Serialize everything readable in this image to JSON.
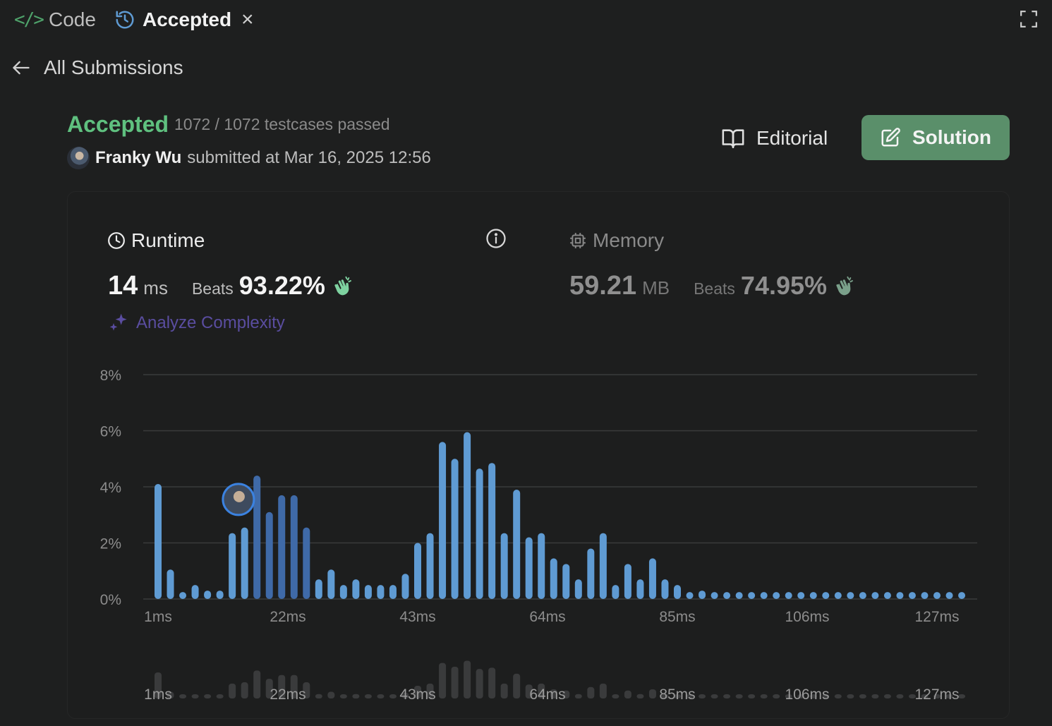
{
  "tabs": {
    "code_label": "Code",
    "code_glyph": "</>",
    "accepted_label": "Accepted",
    "close_glyph": "×"
  },
  "nav": {
    "back_label": "All Submissions"
  },
  "result": {
    "status": "Accepted",
    "testcases": "1072 / 1072 testcases passed",
    "submitter_name": "Franky Wu",
    "submitted_text": "submitted at Mar 16, 2025 12:56"
  },
  "actions": {
    "editorial_label": "Editorial",
    "solution_label": "Solution"
  },
  "runtime": {
    "label": "Runtime",
    "value": "14",
    "unit": "ms",
    "beats_label": "Beats",
    "beats_value": "93.22%"
  },
  "memory": {
    "label": "Memory",
    "value": "59.21",
    "unit": "MB",
    "beats_label": "Beats",
    "beats_value": "74.95%"
  },
  "analyze_label": "Analyze Complexity",
  "colors": {
    "accepted_green": "#5fc07f",
    "bar_light": "#5f9bd3",
    "bar_dark": "#3f6aa8",
    "solution_bg": "#5a8f6a",
    "analyze_purple": "#5a4da0"
  },
  "chart_data": {
    "type": "bar",
    "title": "",
    "xlabel": "",
    "ylabel": "",
    "ylim": [
      0,
      8
    ],
    "y_ticks": [
      "0%",
      "2%",
      "4%",
      "6%",
      "8%"
    ],
    "x_ticks": [
      "1ms",
      "22ms",
      "43ms",
      "64ms",
      "85ms",
      "106ms",
      "127ms"
    ],
    "x_tick_values": [
      1,
      22,
      43,
      64,
      85,
      106,
      127
    ],
    "x": [
      1,
      3,
      5,
      7,
      9,
      11,
      13,
      15,
      17,
      19,
      21,
      23,
      25,
      27,
      29,
      31,
      33,
      35,
      37,
      39,
      41,
      43,
      45,
      47,
      49,
      51,
      53,
      55,
      57,
      59,
      61,
      63,
      65,
      67,
      69,
      71,
      73,
      75,
      77,
      79,
      81,
      83,
      85,
      87,
      89,
      91,
      93,
      95,
      97,
      99,
      101,
      103,
      105,
      107,
      109,
      111,
      113,
      115,
      117,
      119,
      121,
      123,
      125,
      127,
      129,
      131
    ],
    "values": [
      4.1,
      1.05,
      0.25,
      0.5,
      0.3,
      0.3,
      2.35,
      2.55,
      4.4,
      3.1,
      3.7,
      3.7,
      2.55,
      0.7,
      1.05,
      0.5,
      0.7,
      0.5,
      0.5,
      0.5,
      0.9,
      2.0,
      2.35,
      5.6,
      5.0,
      5.95,
      4.65,
      4.85,
      2.35,
      3.9,
      2.2,
      2.35,
      1.45,
      1.25,
      0.7,
      1.8,
      2.35,
      0.5,
      1.25,
      0.7,
      1.45,
      0.7,
      0.5,
      0.25,
      0.3,
      0.25,
      0.25,
      0.25,
      0.25,
      0.25,
      0.25,
      0.25,
      0.25,
      0.25,
      0.25,
      0.25,
      0.25,
      0.25,
      0.25,
      0.25,
      0.25,
      0.25,
      0.25,
      0.25,
      0.25,
      0.25
    ],
    "highlight_range": [
      17,
      25
    ],
    "user_marker_x": 14,
    "overview_brush": true,
    "grid": true
  }
}
